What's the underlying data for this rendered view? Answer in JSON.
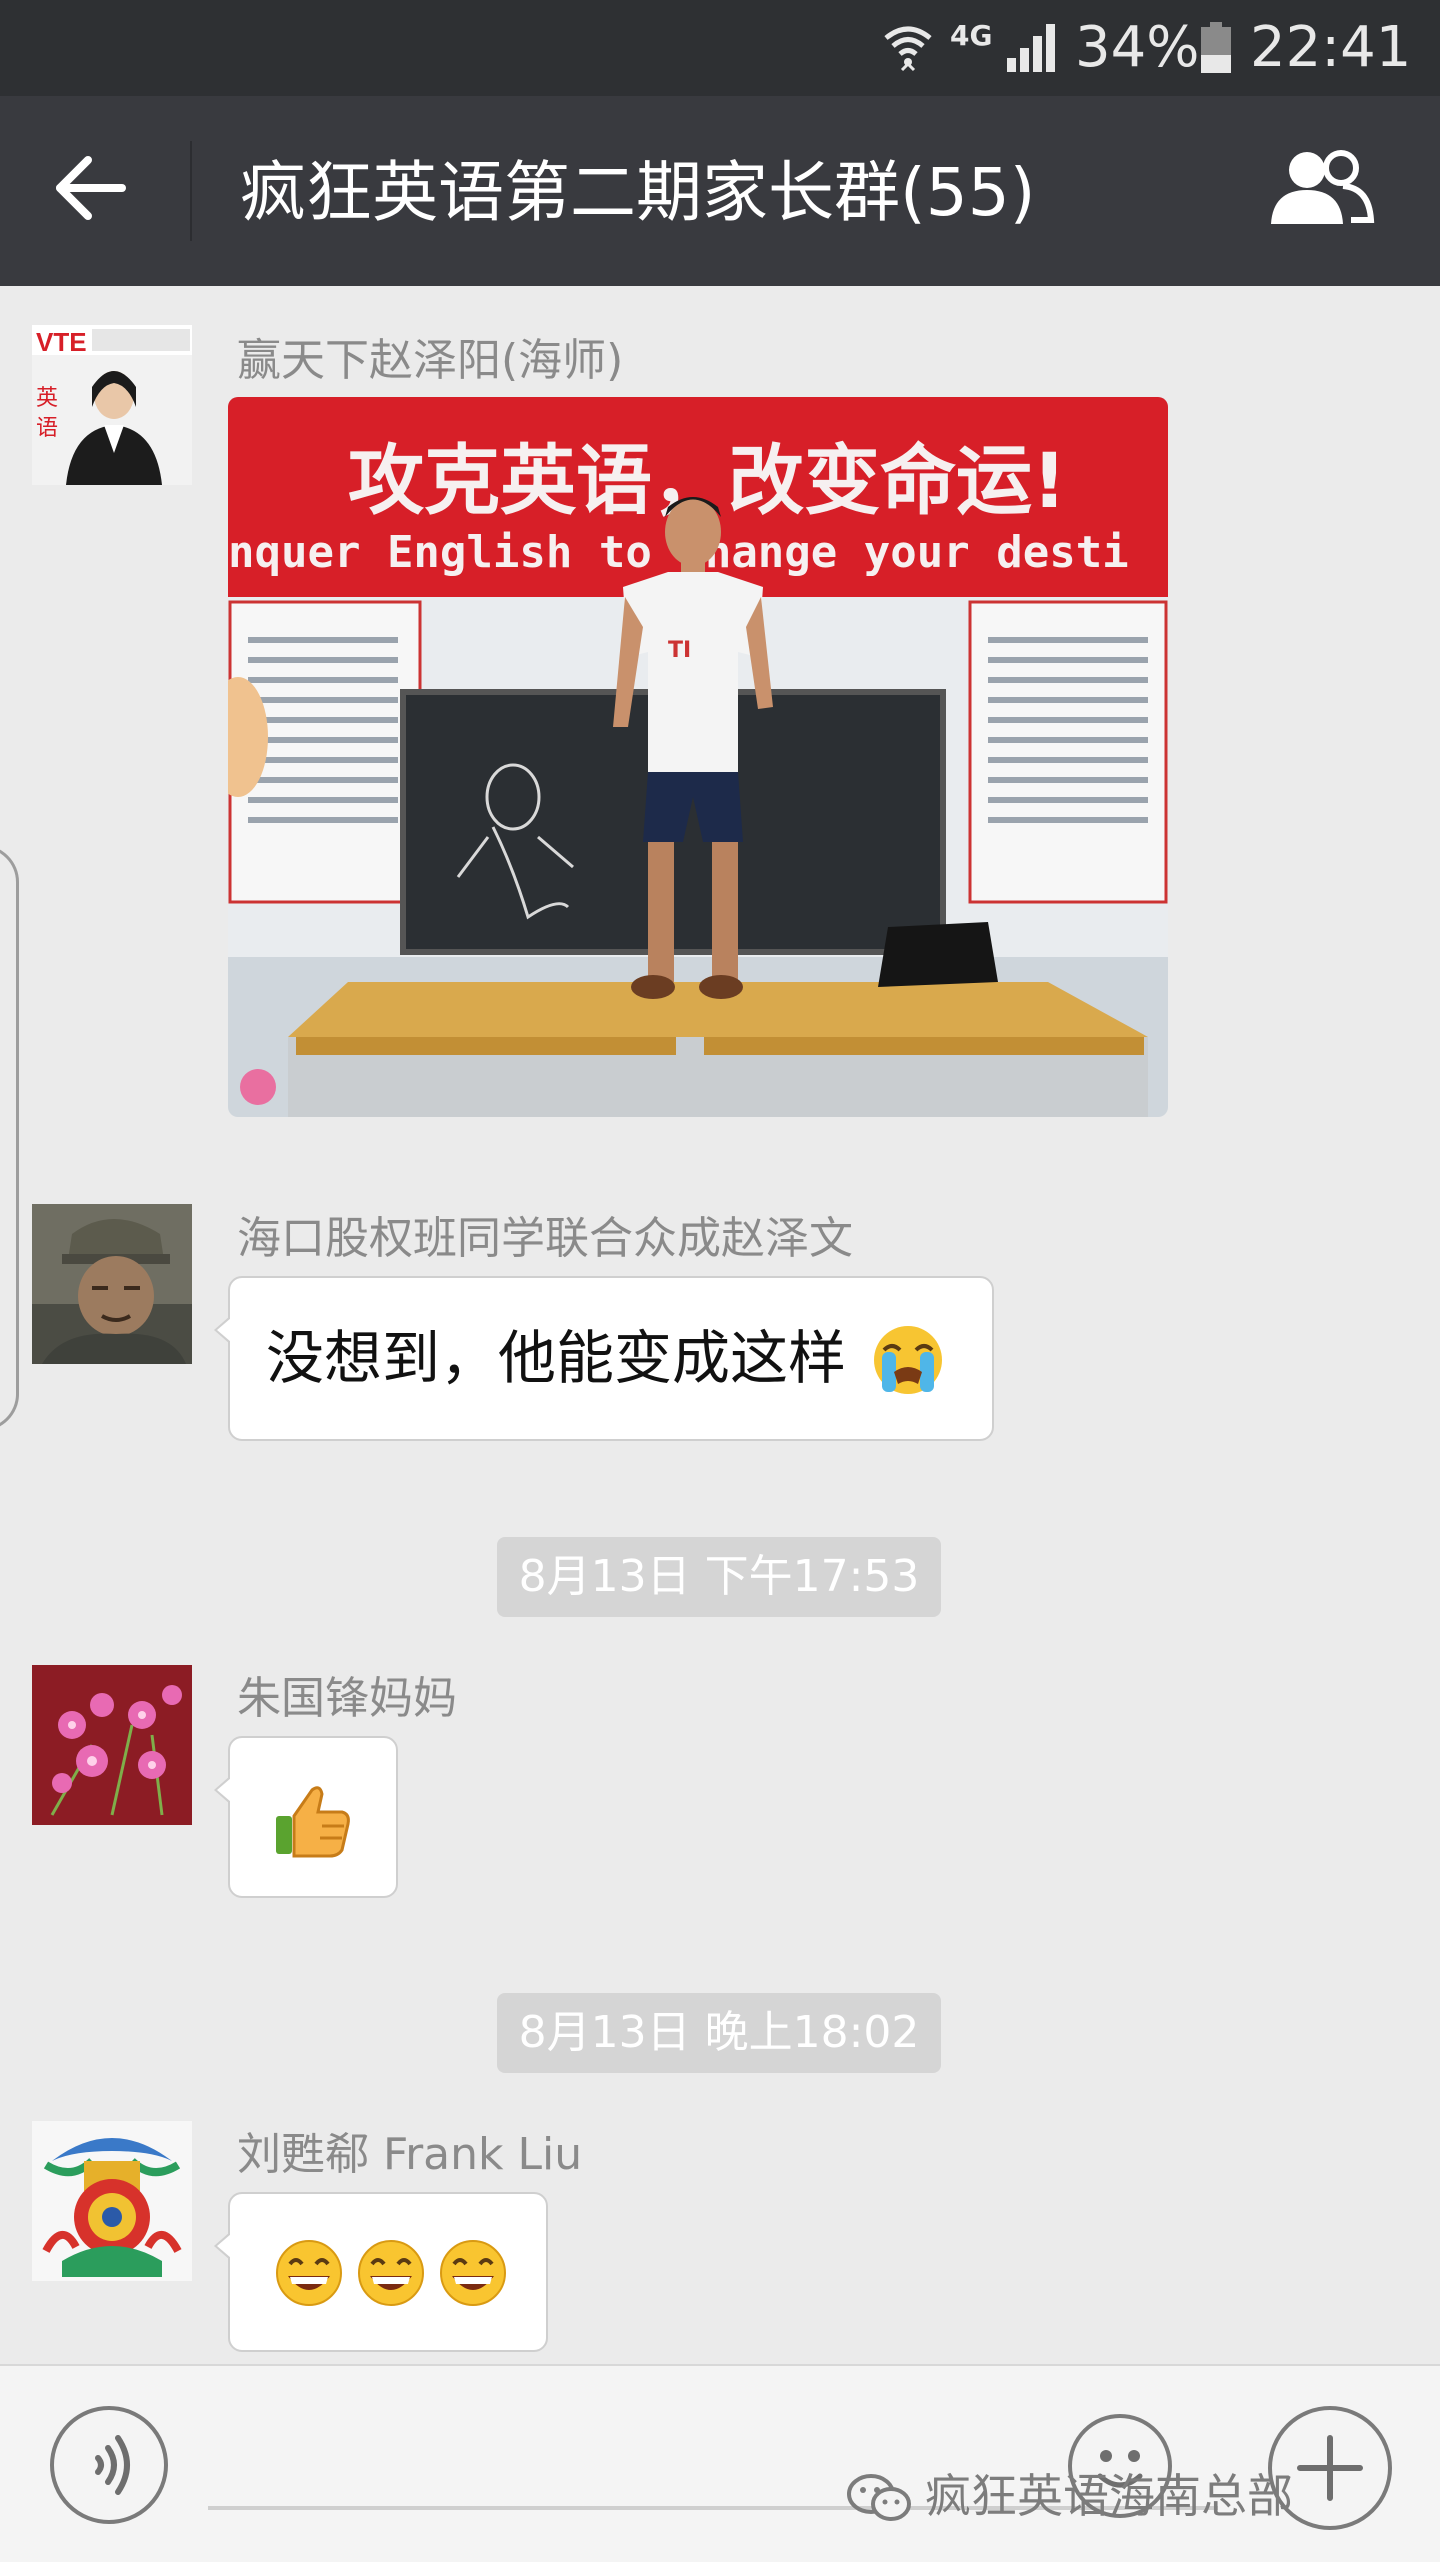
{
  "status_bar": {
    "network": "4G",
    "battery": "34%",
    "time": "22:41"
  },
  "header": {
    "title": "疯狂英语第二期家长群(55)"
  },
  "messages": [
    {
      "sender": "赢天下赵泽阳(海师)",
      "type": "image",
      "image": {
        "banner_cn": "攻克英语，改变命运!",
        "banner_en": "nquer English to change your desti"
      }
    },
    {
      "sender": "海口股权班同学联合众成赵泽文",
      "type": "text",
      "text": "没想到，他能变成这样",
      "emoji": "crying-face"
    },
    {
      "type": "timestamp",
      "text": "8月13日 下午17:53"
    },
    {
      "sender": "朱国锋妈妈",
      "type": "sticker",
      "emoji": "thumbs-up"
    },
    {
      "type": "timestamp",
      "text": "8月13日 晚上18:02"
    },
    {
      "sender": "刘甦郗 Frank Liu",
      "type": "sticker",
      "emoji_count": 3,
      "emoji": "grinning-face"
    }
  ],
  "input_bar": {
    "watermark": "疯狂英语海南总部"
  },
  "colors": {
    "status_bar": "#2e3033",
    "title_bar": "#393a3f",
    "chat_background": "#ebebeb",
    "banner_red": "#d71f28"
  }
}
